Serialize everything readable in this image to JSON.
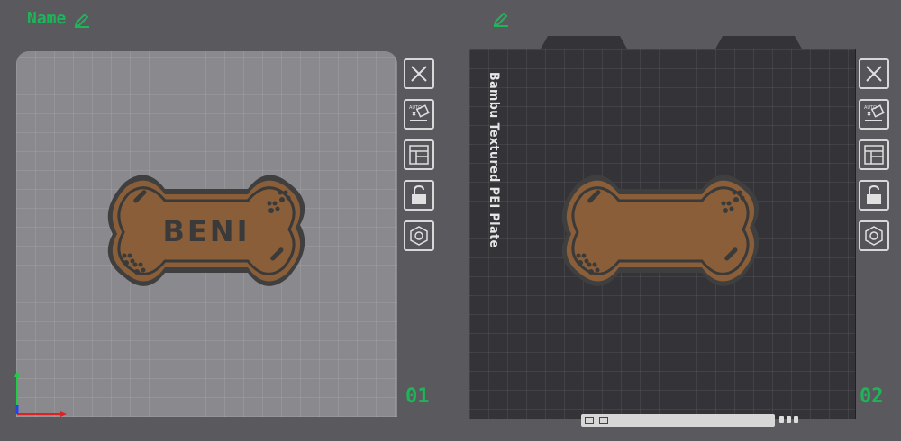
{
  "plates": [
    {
      "name": "Name",
      "number": "01",
      "object_text": "BENI"
    },
    {
      "name": "",
      "number": "02",
      "plate_type": "Bambu Textured PEI Plate"
    }
  ],
  "toolbar_icons": [
    "close-icon",
    "auto-orient-icon",
    "arrange-icon",
    "lock-icon",
    "settings-icon"
  ],
  "colors": {
    "accent": "#1fb45a",
    "bone_fill": "#8a5e38",
    "bone_edge": "#3a3a3a",
    "plate_light": "#8a8a8e",
    "plate_dark": "#343438"
  }
}
